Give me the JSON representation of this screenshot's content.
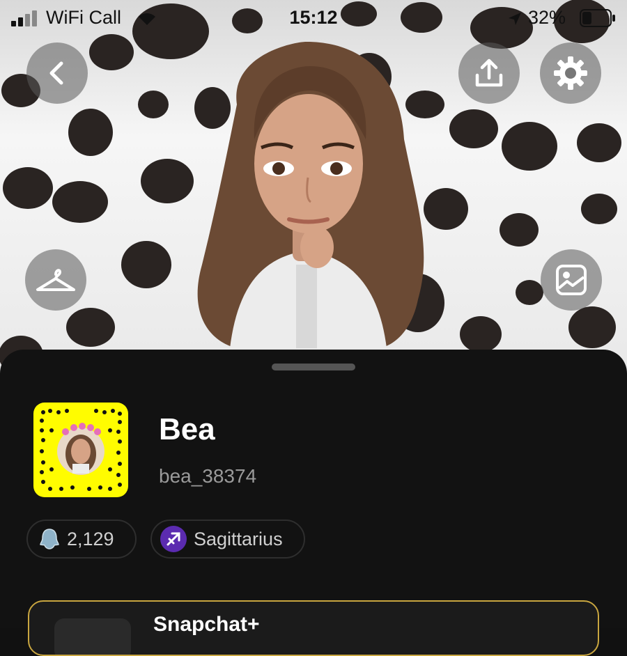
{
  "status_bar": {
    "carrier": "WiFi Call",
    "time": "15:12",
    "battery": "32%"
  },
  "profile": {
    "display_name": "Bea",
    "username": "bea_38374",
    "snapscore": "2,129",
    "zodiac": "Sagittarius"
  },
  "card": {
    "title": "Snapchat+"
  },
  "colors": {
    "snapcode_yellow": "#fffc00",
    "card_border": "#c9a640",
    "zodiac_badge": "#5b2bb0"
  },
  "icons": {
    "back": "chevron-left-icon",
    "share": "upload-icon",
    "settings": "gear-icon",
    "outfit": "hanger-icon",
    "background": "image-icon"
  }
}
